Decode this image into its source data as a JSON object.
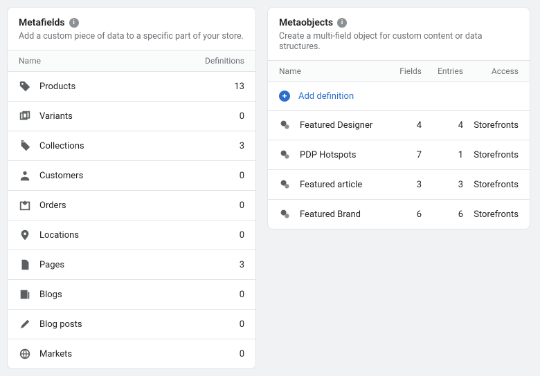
{
  "metafields": {
    "title": "Metafields",
    "subtitle": "Add a custom piece of data to a specific part of your store.",
    "columns": {
      "name": "Name",
      "definitions": "Definitions"
    },
    "rows": [
      {
        "name": "Products",
        "definitions": 13
      },
      {
        "name": "Variants",
        "definitions": 0
      },
      {
        "name": "Collections",
        "definitions": 3
      },
      {
        "name": "Customers",
        "definitions": 0
      },
      {
        "name": "Orders",
        "definitions": 0
      },
      {
        "name": "Locations",
        "definitions": 0
      },
      {
        "name": "Pages",
        "definitions": 3
      },
      {
        "name": "Blogs",
        "definitions": 0
      },
      {
        "name": "Blog posts",
        "definitions": 0
      },
      {
        "name": "Markets",
        "definitions": 0
      }
    ]
  },
  "metaobjects": {
    "title": "Metaobjects",
    "subtitle": "Create a multi-field object for custom content or data structures.",
    "columns": {
      "name": "Name",
      "fields": "Fields",
      "entries": "Entries",
      "access": "Access"
    },
    "add_label": "Add definition",
    "rows": [
      {
        "name": "Featured Designer",
        "fields": 4,
        "entries": 4,
        "access": "Storefronts"
      },
      {
        "name": "PDP Hotspots",
        "fields": 7,
        "entries": 1,
        "access": "Storefronts"
      },
      {
        "name": "Featured article",
        "fields": 3,
        "entries": 3,
        "access": "Storefronts"
      },
      {
        "name": "Featured Brand",
        "fields": 6,
        "entries": 6,
        "access": "Storefronts"
      }
    ]
  }
}
